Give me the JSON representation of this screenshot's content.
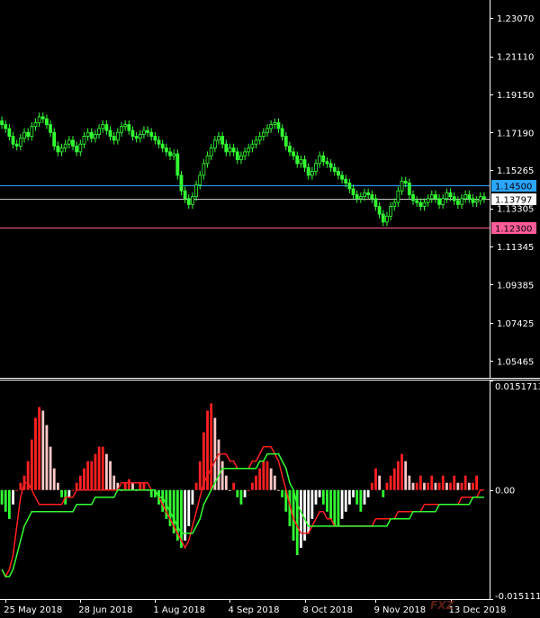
{
  "chart_data": {
    "type": "candlestick",
    "price_axis": {
      "range": [
        1.046,
        1.24
      ],
      "ticks": [
        "1.23070",
        "1.21110",
        "1.19150",
        "1.17190",
        "1.15265",
        "1.13305",
        "1.11345",
        "1.09385",
        "1.07425",
        "1.05465"
      ]
    },
    "price_lines": [
      {
        "label": "1.14500",
        "value": 1.145,
        "color": "#2aa6ff",
        "tag_bg": "#2aa6ff",
        "tag_fg": "#000000"
      },
      {
        "label": "1.13797",
        "value": 1.13797,
        "color": "#c0c0c0",
        "tag_bg": "#ffffff",
        "tag_fg": "#000000"
      },
      {
        "label": "1.12300",
        "value": 1.123,
        "color": "#ff5c9a",
        "tag_bg": "#ff5c9a",
        "tag_fg": "#000000"
      }
    ],
    "candle_color": "#33ff33",
    "closes": [
      1.176,
      1.174,
      1.17,
      1.166,
      1.165,
      1.169,
      1.172,
      1.17,
      1.175,
      1.177,
      1.18,
      1.179,
      1.176,
      1.172,
      1.165,
      1.162,
      1.164,
      1.166,
      1.168,
      1.165,
      1.162,
      1.166,
      1.17,
      1.172,
      1.169,
      1.171,
      1.174,
      1.176,
      1.173,
      1.17,
      1.168,
      1.172,
      1.175,
      1.176,
      1.173,
      1.17,
      1.169,
      1.171,
      1.173,
      1.172,
      1.17,
      1.168,
      1.166,
      1.164,
      1.162,
      1.16,
      1.161,
      1.15,
      1.142,
      1.138,
      1.135,
      1.139,
      1.145,
      1.15,
      1.156,
      1.16,
      1.164,
      1.168,
      1.17,
      1.166,
      1.162,
      1.164,
      1.162,
      1.158,
      1.16,
      1.162,
      1.164,
      1.166,
      1.168,
      1.17,
      1.172,
      1.174,
      1.176,
      1.177,
      1.174,
      1.17,
      1.165,
      1.162,
      1.16,
      1.156,
      1.158,
      1.154,
      1.15,
      1.152,
      1.156,
      1.16,
      1.157,
      1.156,
      1.154,
      1.152,
      1.15,
      1.148,
      1.146,
      1.143,
      1.14,
      1.138,
      1.139,
      1.141,
      1.14,
      1.138,
      1.134,
      1.13,
      1.126,
      1.129,
      1.134,
      1.136,
      1.142,
      1.147,
      1.146,
      1.14,
      1.137,
      1.136,
      1.134,
      1.136,
      1.138,
      1.14,
      1.138,
      1.135,
      1.138,
      1.141,
      1.139,
      1.137,
      1.135,
      1.138,
      1.14,
      1.138,
      1.136,
      1.137,
      1.139,
      1.138
    ],
    "x_axis_labels": [
      {
        "text": "25 May 2018",
        "index": 1
      },
      {
        "text": "28 Jun 2018",
        "index": 21
      },
      {
        "text": "1 Aug 2018",
        "index": 41
      },
      {
        "text": "4 Sep 2018",
        "index": 61
      },
      {
        "text": "8 Oct 2018",
        "index": 81
      },
      {
        "text": "9 Nov 2018",
        "index": 100
      },
      {
        "text": "13 Dec 2018",
        "index": 120
      }
    ],
    "indicator": {
      "ticks": [
        "0.0151713",
        "0.00",
        "-0.015111"
      ],
      "range": [
        -0.015111,
        0.0151713
      ],
      "histogram": [
        -0.002,
        -0.003,
        -0.004,
        -0.002,
        0,
        0.001,
        0.002,
        0.004,
        0.007,
        0.01,
        0.0115,
        0.011,
        0.009,
        0.006,
        0.003,
        0.001,
        -0.001,
        -0.002,
        -0.001,
        0.0,
        0.001,
        0.002,
        0.003,
        0.004,
        0.004,
        0.005,
        0.006,
        0.006,
        0.005,
        0.004,
        0.002,
        0.001,
        0.0,
        0.001,
        0.0015,
        0.001,
        0.0,
        0.001,
        0.001,
        0.0,
        -0.001,
        -0.001,
        -0.002,
        -0.003,
        -0.004,
        -0.005,
        -0.006,
        -0.007,
        -0.008,
        -0.007,
        -0.005,
        -0.002,
        0.001,
        0.004,
        0.008,
        0.011,
        0.012,
        0.01,
        0.007,
        0.004,
        0.002,
        0.0,
        0.001,
        -0.001,
        -0.002,
        -0.001,
        0.0,
        0.001,
        0.002,
        0.003,
        0.004,
        0.004,
        0.003,
        0.002,
        0.0,
        -0.001,
        -0.003,
        -0.005,
        -0.007,
        -0.009,
        -0.008,
        -0.007,
        -0.006,
        -0.004,
        -0.002,
        -0.001,
        -0.002,
        -0.003,
        -0.004,
        -0.005,
        -0.005,
        -0.004,
        -0.003,
        -0.002,
        -0.001,
        -0.002,
        -0.003,
        -0.002,
        -0.001,
        0.001,
        0.003,
        0.002,
        -0.001,
        0.001,
        0.002,
        0.003,
        0.004,
        0.005,
        0.004,
        0.002,
        0.001,
        0.001,
        0.002,
        0.001,
        0.001,
        0.002,
        0.001,
        0.001,
        0.002,
        0.001,
        0.001,
        0.002,
        0.001,
        0.001,
        0.002,
        0.001,
        0.001,
        0.002
      ],
      "main_color": "#ff2020",
      "signal_color": "#33ff33",
      "main": [
        -0.011,
        -0.012,
        -0.011,
        -0.009,
        -0.005,
        -0.001,
        0.001,
        0.001,
        0.0,
        -0.001,
        -0.002,
        -0.002,
        -0.002,
        -0.002,
        -0.002,
        -0.002,
        -0.002,
        -0.001,
        -0.001,
        -0.001,
        0.0,
        0.0,
        0.0,
        0.0,
        0.0,
        0.0,
        0.0,
        0.0,
        0.0,
        0.0,
        0.0,
        0.0,
        0.001,
        0.001,
        0.001,
        0.001,
        0.001,
        0.001,
        0.001,
        0.001,
        0.0,
        0.0,
        -0.001,
        -0.002,
        -0.003,
        -0.004,
        -0.005,
        -0.006,
        -0.007,
        -0.008,
        -0.007,
        -0.005,
        -0.003,
        -0.001,
        0.001,
        0.002,
        0.003,
        0.004,
        0.005,
        0.005,
        0.005,
        0.004,
        0.004,
        0.003,
        0.003,
        0.003,
        0.003,
        0.004,
        0.004,
        0.005,
        0.006,
        0.006,
        0.006,
        0.005,
        0.004,
        0.002,
        0.0,
        -0.002,
        -0.004,
        -0.005,
        -0.006,
        -0.006,
        -0.006,
        -0.005,
        -0.004,
        -0.003,
        -0.003,
        -0.004,
        -0.004,
        -0.005,
        -0.005,
        -0.005,
        -0.005,
        -0.005,
        -0.005,
        -0.005,
        -0.005,
        -0.005,
        -0.005,
        -0.005,
        -0.004,
        -0.004,
        -0.004,
        -0.004,
        -0.004,
        -0.004,
        -0.003,
        -0.003,
        -0.003,
        -0.003,
        -0.003,
        -0.003,
        -0.003,
        -0.002,
        -0.002,
        -0.002,
        -0.002,
        -0.002,
        -0.002,
        -0.002,
        -0.002,
        -0.002,
        -0.002,
        -0.001,
        -0.001,
        -0.001,
        -0.001,
        -0.001,
        0.0,
        0.0
      ],
      "signal": [
        -0.011,
        -0.012,
        -0.012,
        -0.011,
        -0.009,
        -0.007,
        -0.005,
        -0.004,
        -0.003,
        -0.003,
        -0.003,
        -0.003,
        -0.003,
        -0.003,
        -0.003,
        -0.003,
        -0.003,
        -0.003,
        -0.003,
        -0.003,
        -0.002,
        -0.002,
        -0.002,
        -0.002,
        -0.002,
        -0.001,
        -0.001,
        -0.001,
        -0.001,
        -0.001,
        -0.001,
        0.0,
        0.0,
        0.0,
        0.0,
        0.0,
        0.0,
        0.0,
        0.0,
        0.0,
        0.0,
        0.0,
        -0.001,
        -0.001,
        -0.002,
        -0.003,
        -0.004,
        -0.005,
        -0.006,
        -0.006,
        -0.006,
        -0.006,
        -0.005,
        -0.004,
        -0.002,
        -0.001,
        0.0,
        0.001,
        0.002,
        0.003,
        0.003,
        0.003,
        0.003,
        0.003,
        0.003,
        0.003,
        0.003,
        0.003,
        0.003,
        0.004,
        0.004,
        0.005,
        0.005,
        0.005,
        0.005,
        0.004,
        0.003,
        0.001,
        0.0,
        -0.002,
        -0.003,
        -0.004,
        -0.005,
        -0.005,
        -0.005,
        -0.005,
        -0.005,
        -0.005,
        -0.005,
        -0.005,
        -0.005,
        -0.005,
        -0.005,
        -0.005,
        -0.005,
        -0.005,
        -0.005,
        -0.005,
        -0.005,
        -0.005,
        -0.005,
        -0.005,
        -0.005,
        -0.005,
        -0.004,
        -0.004,
        -0.004,
        -0.004,
        -0.004,
        -0.004,
        -0.003,
        -0.003,
        -0.003,
        -0.003,
        -0.003,
        -0.003,
        -0.003,
        -0.002,
        -0.002,
        -0.002,
        -0.002,
        -0.002,
        -0.002,
        -0.002,
        -0.002,
        -0.002,
        -0.001,
        -0.001,
        -0.001,
        -0.001
      ]
    }
  },
  "watermark": {
    "text": "FXZ"
  },
  "colors": {
    "background": "#000000",
    "frame": "#ffffff"
  }
}
